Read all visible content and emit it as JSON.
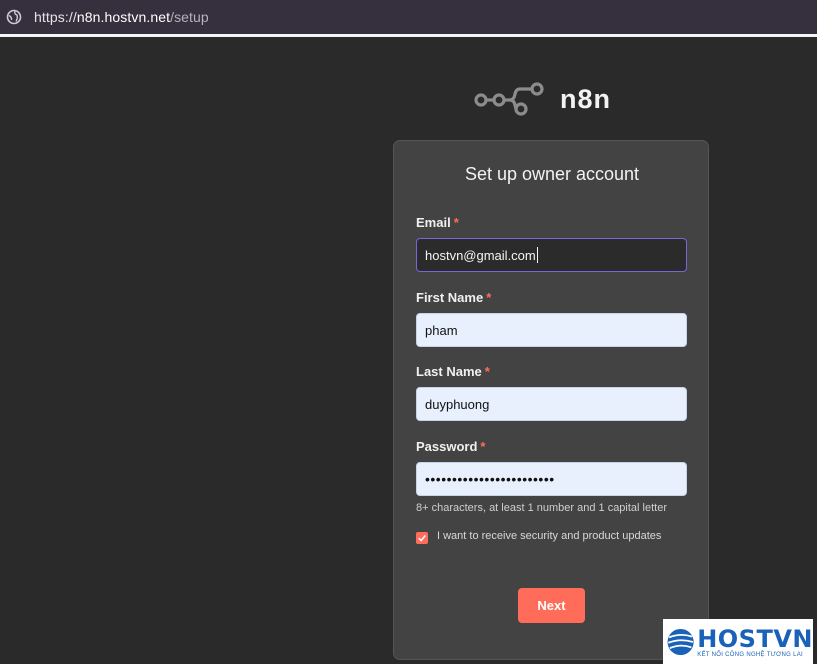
{
  "browser": {
    "url_prefix": "https://",
    "url_host": "n8n.hostvn.net",
    "url_path": "/setup",
    "site_icon": "globe-icon"
  },
  "app": {
    "logo_text": "n8n",
    "logo_icon": "n8n-logo-icon"
  },
  "form": {
    "title": "Set up owner account",
    "required_marker": "*",
    "email": {
      "label": "Email",
      "value": "hostvn@gmail.com"
    },
    "first_name": {
      "label": "First Name",
      "value": "pham"
    },
    "last_name": {
      "label": "Last Name",
      "value": "duyphuong"
    },
    "password": {
      "label": "Password",
      "masked_value": "••••••••••••••••••••••••",
      "hint": "8+ characters, at least 1 number and 1 capital letter"
    },
    "updates_checkbox": {
      "label": "I want to receive security and product updates",
      "checked": true
    },
    "next_label": "Next"
  },
  "watermark": {
    "brand": "HOSTVN",
    "tagline": "KẾT NỐI CÔNG NGHỆ TƯƠNG LAI"
  },
  "colors": {
    "accent": "#ff6d5a",
    "focus_border": "#7a66d8",
    "background": "#2a2a2a",
    "card": "#434343",
    "watermark_blue": "#1a62b8"
  }
}
